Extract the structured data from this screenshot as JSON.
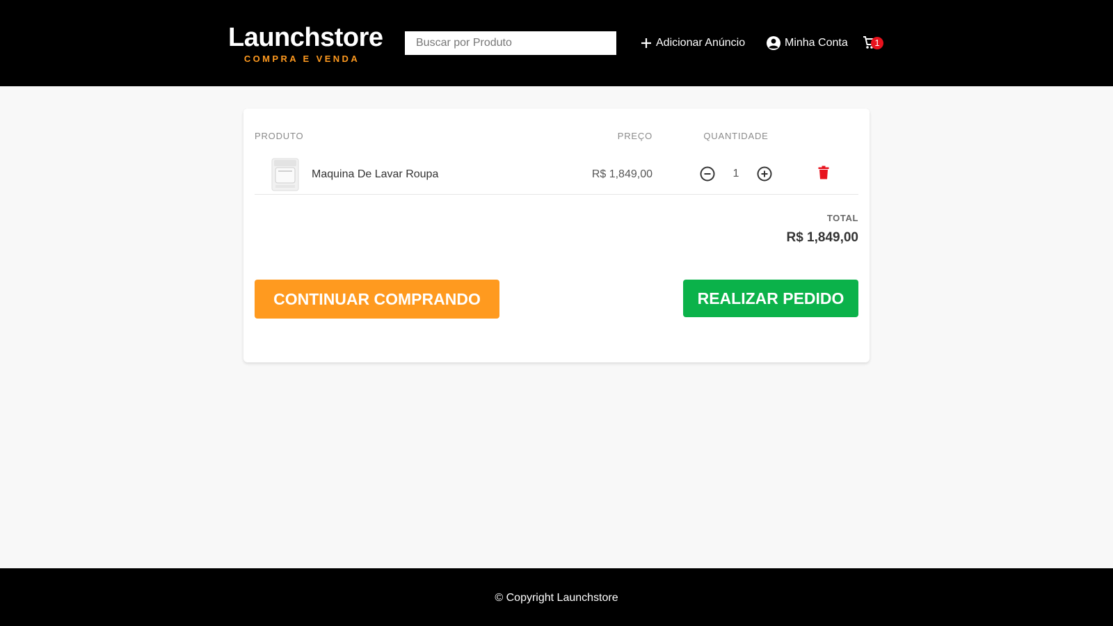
{
  "header": {
    "logo_title": "Launchstore",
    "logo_subtitle": "COMPRA E VENDA",
    "search_placeholder": "Buscar por Produto",
    "add_listing_label": "Adicionar Anúncio",
    "account_label": "Minha Conta",
    "cart_count": "1",
    "icons": [
      "plus-icon",
      "account-icon",
      "cart-icon"
    ]
  },
  "cart_table": {
    "headers": {
      "product": "PRODUTO",
      "price": "PREÇO",
      "quantity": "QUANTIDADE"
    },
    "items": [
      {
        "name": "Maquina De Lavar Roupa",
        "price": "R$ 1,849,00",
        "quantity": "1"
      }
    ],
    "total_label": "TOTAL",
    "total_value": "R$ 1,849,00"
  },
  "actions": {
    "continue_label": "CONTINUAR COMPRANDO",
    "order_label": "REALIZAR PEDIDO"
  },
  "footer": {
    "copyright": "© Copyright Launchstore"
  },
  "colors": {
    "header_bg": "#000000",
    "accent_orange": "#ff9a1f",
    "accent_green": "#0bb24a",
    "badge_red": "#e8121d",
    "delete_red": "#e8121d",
    "page_bg": "#f8f8f8"
  }
}
